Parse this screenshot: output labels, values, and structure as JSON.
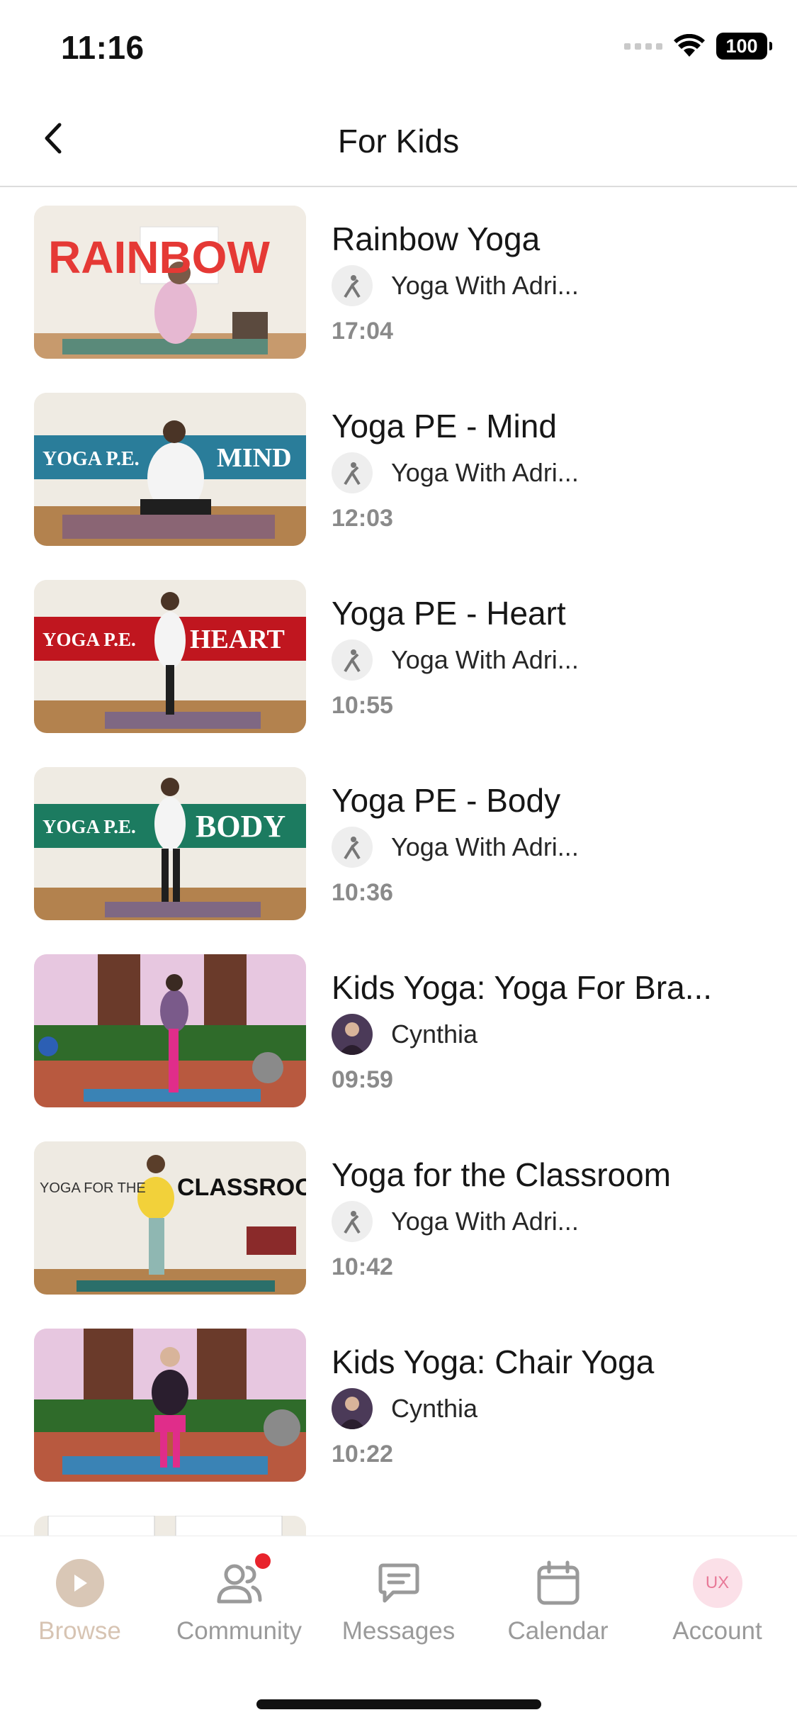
{
  "status_bar": {
    "time": "11:16",
    "battery": "100"
  },
  "nav": {
    "title": "For Kids"
  },
  "videos": [
    {
      "title": "Rainbow Yoga",
      "channel": "Yoga With Adri...",
      "duration": "17:04",
      "thumb_text": "RAINBOW"
    },
    {
      "title": "Yoga PE - Mind",
      "channel": "Yoga With Adri...",
      "duration": "12:03",
      "thumb_text_left": "YOGA P.E.",
      "thumb_text_right": "MIND"
    },
    {
      "title": "Yoga PE - Heart",
      "channel": "Yoga With Adri...",
      "duration": "10:55",
      "thumb_text_left": "YOGA P.E.",
      "thumb_text_right": "HEART"
    },
    {
      "title": "Yoga PE - Body",
      "channel": "Yoga With Adri...",
      "duration": "10:36",
      "thumb_text_left": "YOGA P.E.",
      "thumb_text_right": "BODY"
    },
    {
      "title": "Kids Yoga: Yoga For Bra...",
      "channel": "Cynthia",
      "duration": "09:59"
    },
    {
      "title": "Yoga for the Classroom",
      "channel": "Yoga With Adri...",
      "duration": "10:42",
      "thumb_text_left": "YOGA FOR THE",
      "thumb_text_right": "CLASSROOM"
    },
    {
      "title": "Kids Yoga: Chair Yoga",
      "channel": "Cynthia",
      "duration": "10:22"
    }
  ],
  "tabs": [
    {
      "label": "Browse",
      "icon": "play-icon",
      "active": true
    },
    {
      "label": "Community",
      "icon": "community-icon",
      "badge": true
    },
    {
      "label": "Messages",
      "icon": "message-icon"
    },
    {
      "label": "Calendar",
      "icon": "calendar-icon"
    },
    {
      "label": "Account",
      "icon": "account-avatar",
      "avatar_text": "UX"
    }
  ],
  "colors": {
    "active_tab": "#d7c4b3",
    "inactive_tab": "#9a9a9a",
    "badge": "#e8232c",
    "duration_text": "#8a8a8a"
  }
}
